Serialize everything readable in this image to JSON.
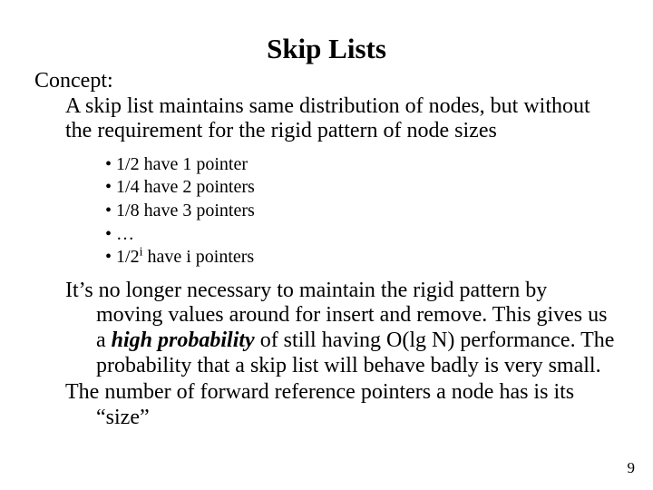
{
  "title": "Skip Lists",
  "concept": {
    "label": "Concept:",
    "body": "A skip list maintains same distribution of nodes, but without the requirement for the rigid pattern of node sizes"
  },
  "bullets": {
    "b1": "1/2 have 1 pointer",
    "b2": "1/4 have 2 pointers",
    "b3": "1/8 have 3 pointers",
    "b4": "…",
    "b5_prefix": "1/2",
    "b5_sup": "i",
    "b5_suffix": " have i pointers"
  },
  "para1": {
    "t1": "It’s no longer necessary to maintain the rigid pattern by moving values around for insert and remove.  This gives us a ",
    "hp": "high probability",
    "t2": " of still having O(lg N) performance.  The probability that a skip list will behave badly is very small."
  },
  "para2": "The number of forward reference pointers a node has is its “size”",
  "page_number": "9"
}
